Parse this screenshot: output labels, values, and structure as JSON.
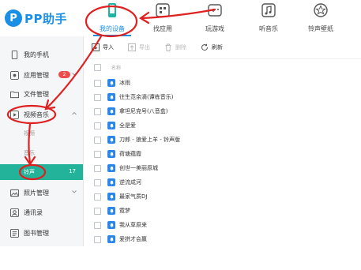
{
  "app": {
    "logo_letter": "P",
    "logo_text": "PP助手"
  },
  "nav": [
    {
      "label": "我的设备",
      "icon": "phone-icon",
      "active": true
    },
    {
      "label": "找应用",
      "icon": "apps-icon",
      "active": false
    },
    {
      "label": "玩游戏",
      "icon": "gamepad-icon",
      "active": false
    },
    {
      "label": "听音乐",
      "icon": "music-icon",
      "active": false
    },
    {
      "label": "铃声壁纸",
      "icon": "ringtone-icon",
      "active": false
    }
  ],
  "sidebar": {
    "items": [
      {
        "label": "我的手机",
        "icon": "phone-outline-icon"
      },
      {
        "label": "应用管理",
        "icon": "app-manage-icon",
        "badge": "2"
      },
      {
        "label": "文件管理",
        "icon": "folder-icon"
      },
      {
        "label": "视频音乐",
        "icon": "video-music-icon",
        "expanded": true
      },
      {
        "label": "照片管理",
        "icon": "photo-icon"
      },
      {
        "label": "通讯录",
        "icon": "contacts-icon"
      },
      {
        "label": "图书管理",
        "icon": "book-icon"
      }
    ],
    "sub_items": [
      {
        "label": "视频"
      },
      {
        "label": "音乐"
      },
      {
        "label": "铃声",
        "count": "17",
        "active": true
      }
    ]
  },
  "toolbar": {
    "import_label": "导入",
    "export_label": "导出",
    "delete_label": "删除",
    "refresh_label": "刷新"
  },
  "list": {
    "header": "名称",
    "rows": [
      "冰雨",
      "往生范余滴(谭栋音乐)",
      "拿坦尼克号(八音盒)",
      "全是爱",
      "刀郎 - 狼爱上羊 - 铃声版",
      "荷塘蕴霞",
      "创世一美丽原城",
      "逆流成河",
      "最家气质DJ",
      "霓梦",
      "我从草原来",
      "爱拼才会赢"
    ]
  },
  "colors": {
    "accent": "#1a8fe6",
    "active_sidebar": "#22b39a",
    "badge": "#f04b4b",
    "annotation": "#e02020"
  }
}
